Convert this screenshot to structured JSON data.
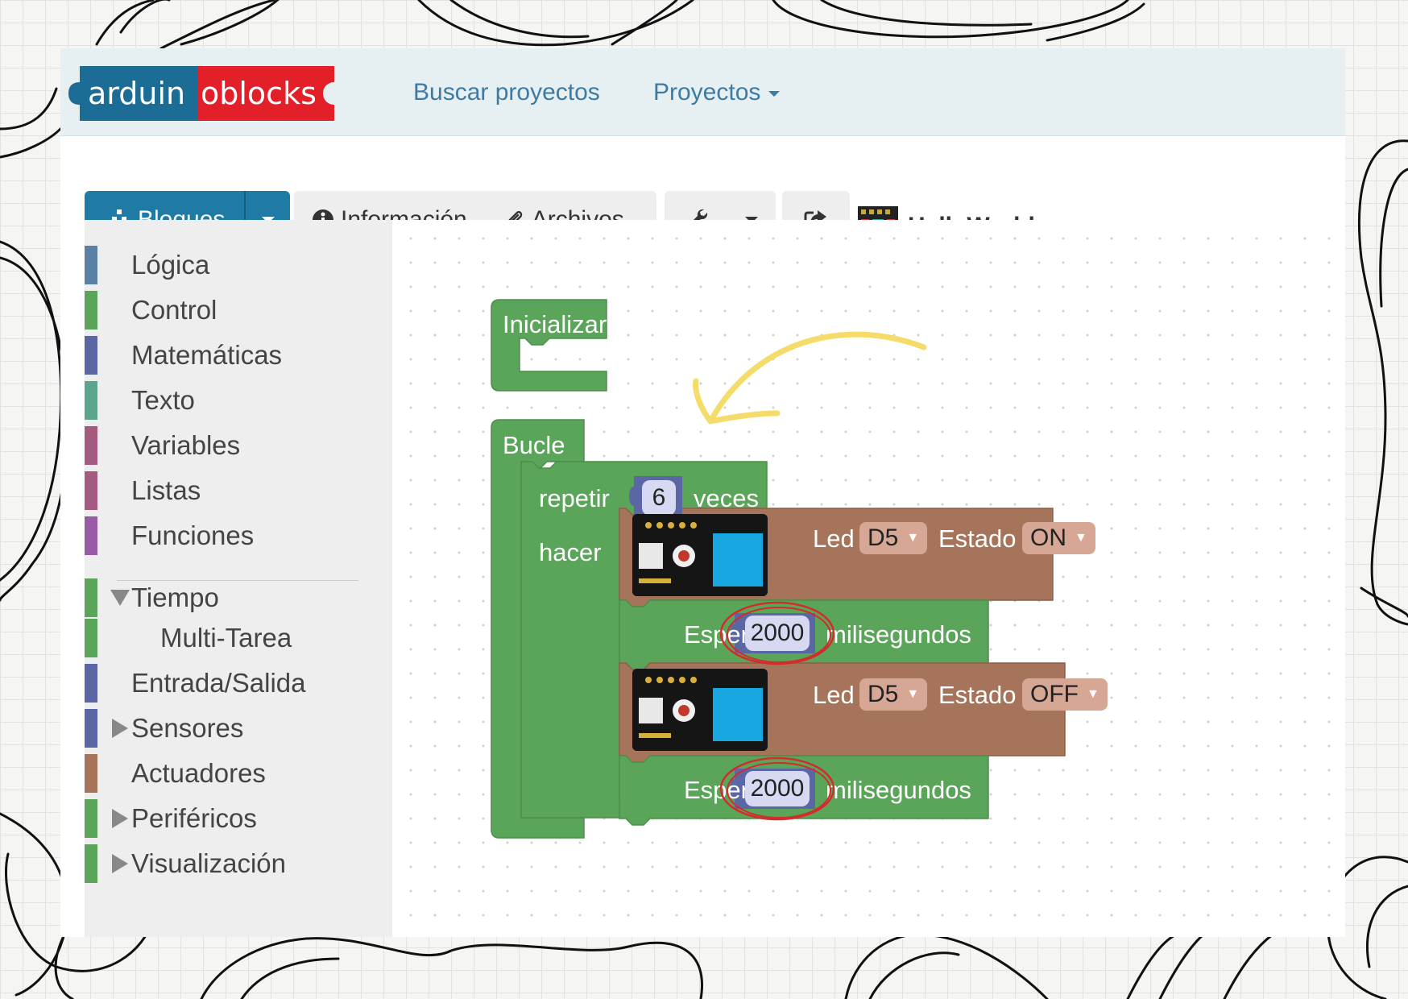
{
  "navbar": {
    "logo": {
      "left_text": "arduin",
      "right_text": "oblocks"
    },
    "links": [
      {
        "label": "Buscar proyectos"
      },
      {
        "label": "Proyectos"
      }
    ]
  },
  "toolbar": {
    "bloques_label": "Bloques",
    "tabs": [
      {
        "label": "Información",
        "icon": "info-circle-icon"
      },
      {
        "label": "Archivos",
        "icon": "paperclip-icon"
      }
    ],
    "tools_icon": "wrench-icon",
    "share_icon": "share-icon",
    "project_name": "HelloWorld"
  },
  "sidebar": {
    "categories": [
      {
        "label": "Lógica",
        "color": "#5b80a5",
        "arrow": "none"
      },
      {
        "label": "Control",
        "color": "#5ba55b",
        "arrow": "none"
      },
      {
        "label": "Matemáticas",
        "color": "#5b67a5",
        "arrow": "none"
      },
      {
        "label": "Texto",
        "color": "#5ba58c",
        "arrow": "none"
      },
      {
        "label": "Variables",
        "color": "#a55b80",
        "arrow": "none"
      },
      {
        "label": "Listas",
        "color": "#a55b80",
        "arrow": "none"
      },
      {
        "label": "Funciones",
        "color": "#995ba5",
        "arrow": "none"
      },
      {
        "label": "Tiempo",
        "color": "#5ba55b",
        "arrow": "down"
      },
      {
        "label": "Multi-Tarea",
        "color": "#5ba55b",
        "arrow": "indent"
      },
      {
        "label": "Entrada/Salida",
        "color": "#5b67a5",
        "arrow": "none"
      },
      {
        "label": "Sensores",
        "color": "#5b67a5",
        "arrow": "right"
      },
      {
        "label": "Actuadores",
        "color": "#a5745b",
        "arrow": "none"
      },
      {
        "label": "Periféricos",
        "color": "#5ba55b",
        "arrow": "right"
      },
      {
        "label": "Visualización",
        "color": "#5ba55b",
        "arrow": "right"
      }
    ]
  },
  "workspace": {
    "colors": {
      "green": "#5ba55b",
      "brown": "#a5745b",
      "math": "#5b67a5",
      "annotation_arrow": "#f5dc6a",
      "annotation_circle": "#d42b2b"
    },
    "init_block": {
      "label": "Inicializar"
    },
    "loop_block": {
      "label": "Bucle"
    },
    "repeat_block": {
      "repeat_label": "repetir",
      "times_value": "6",
      "times_label": "veces",
      "do_label": "hacer"
    },
    "led_on": {
      "led_label": "Led",
      "pin": "D5",
      "state_label": "Estado",
      "state": "ON"
    },
    "wait_1": {
      "label": "Esperar",
      "value": "2000",
      "unit": "milisegundos"
    },
    "led_off": {
      "led_label": "Led",
      "pin": "D5",
      "state_label": "Estado",
      "state": "OFF"
    },
    "wait_2": {
      "label": "Esperar",
      "value": "2000",
      "unit": "milisegundos"
    }
  }
}
